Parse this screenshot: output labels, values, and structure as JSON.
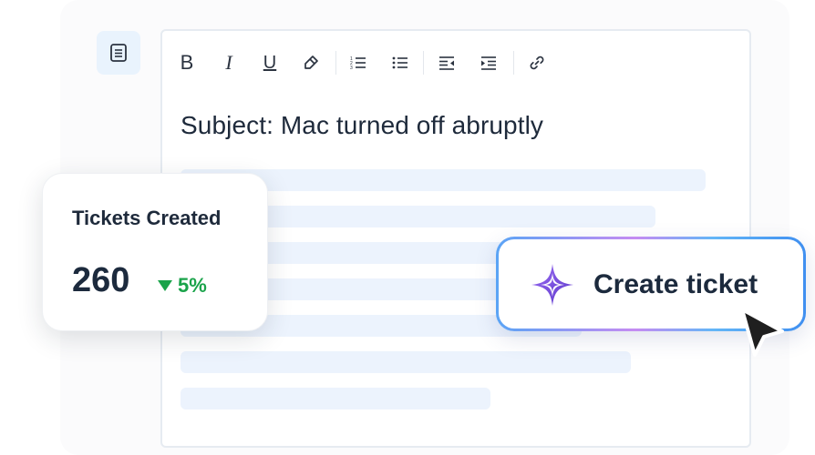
{
  "sidebar": {
    "doc_icon": "document-icon"
  },
  "toolbar": {
    "icons": [
      "bold-icon",
      "italic-icon",
      "underline-icon",
      "highlight-icon",
      "ordered-list-icon",
      "bullet-list-icon",
      "outdent-icon",
      "indent-icon",
      "link-icon"
    ],
    "bold_glyph": "B",
    "italic_glyph": "I",
    "underline_glyph": "U"
  },
  "editor": {
    "subject": "Subject: Mac turned off abruptly",
    "placeholder_line_count": 7
  },
  "stat_card": {
    "title": "Tickets Created",
    "value": "260",
    "change": "5%",
    "change_direction": "down",
    "change_color": "#1aa34a"
  },
  "cta": {
    "label": "Create ticket",
    "icon": "sparkle-icon",
    "accent": "#7b4fe0"
  }
}
